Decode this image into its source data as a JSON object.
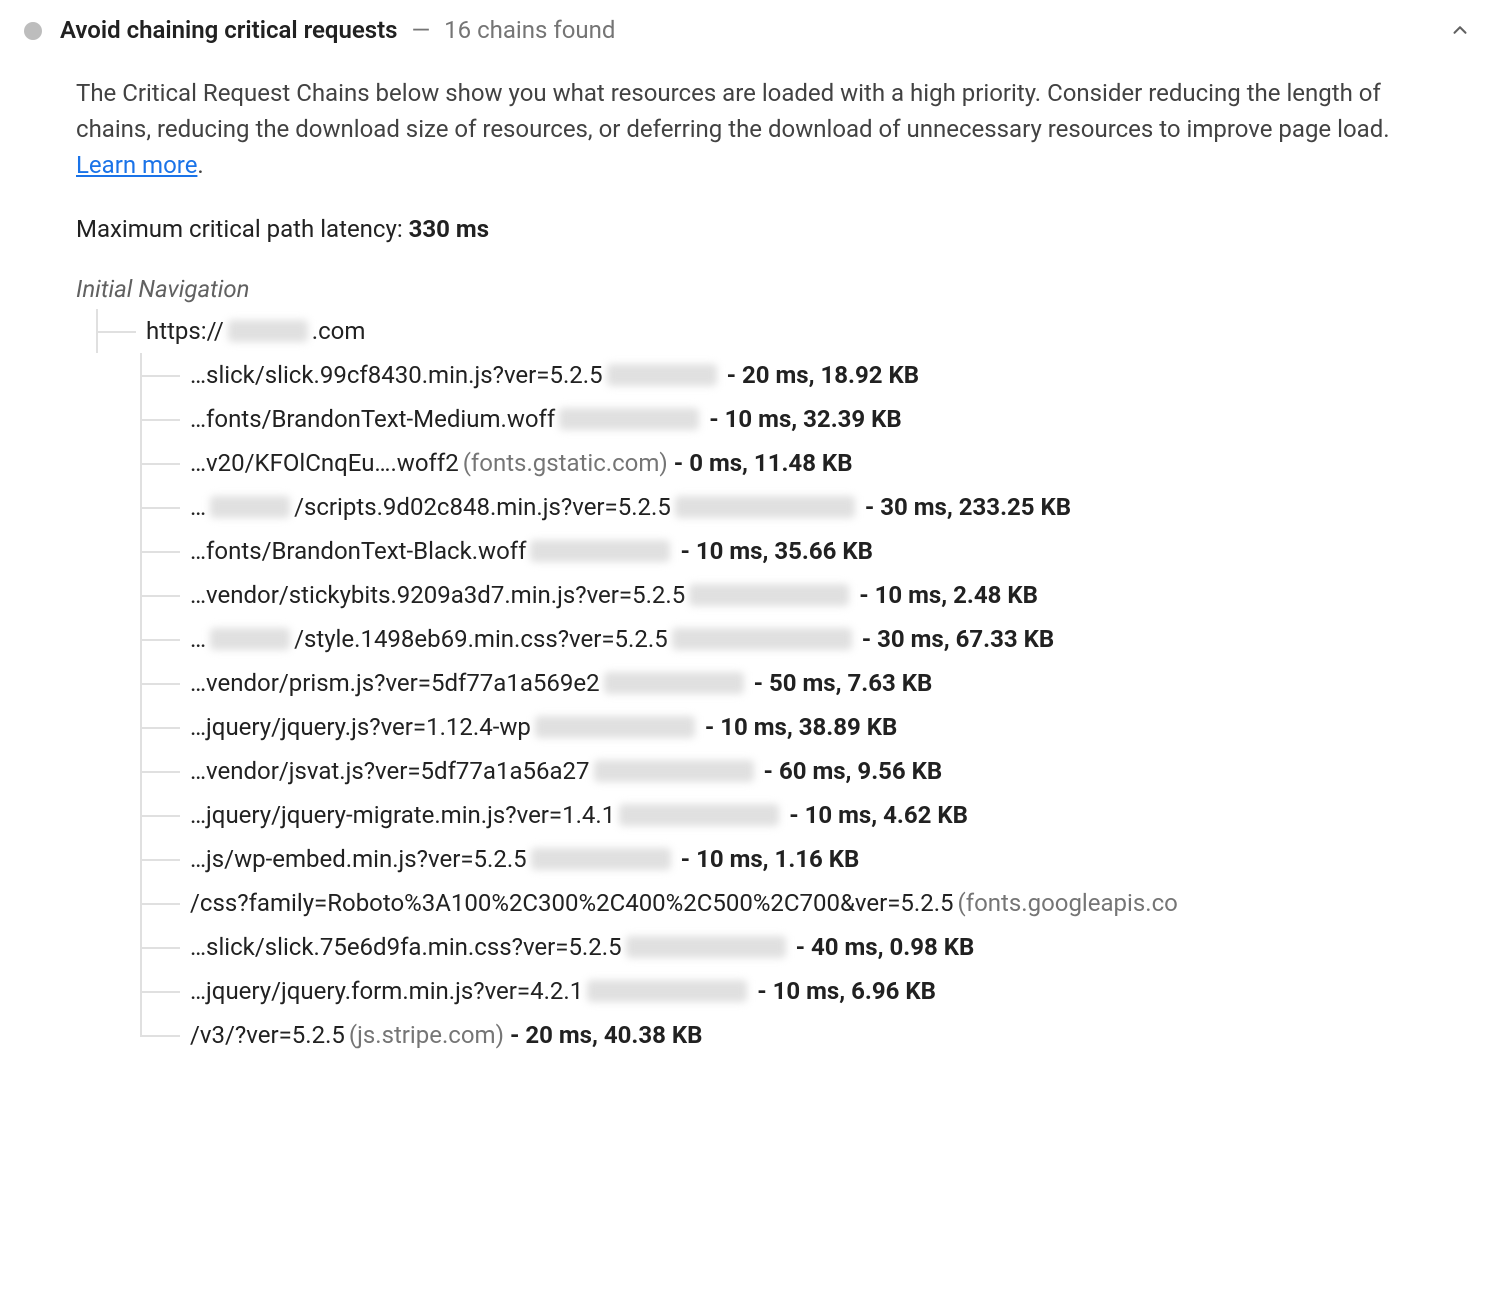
{
  "audit": {
    "title": "Avoid chaining critical requests",
    "separator": "—",
    "subtext": "16 chains found",
    "description_pre": "The Critical Request Chains below show you what resources are loaded with a high priority. Consider reducing the length of chains, reducing the download size of resources, or deferring the download of unnecessary resources to improve page load. ",
    "learn_more": "Learn more",
    "description_post": "."
  },
  "latency": {
    "label": "Maximum critical path latency: ",
    "value": "330 ms"
  },
  "tree": {
    "initial_label": "Initial Navigation",
    "root_url_pre": "https://",
    "root_url_post": ".com",
    "root_host_blurred": true,
    "children": [
      {
        "path": "…slick/slick.99cf8430.min.js?ver=5.2.5",
        "host_blurred": true,
        "host_text": "",
        "time": "20 ms",
        "size": "18.92 KB"
      },
      {
        "path": "…fonts/BrandonText-Medium.woff",
        "host_blurred": true,
        "host_text": "",
        "time": "10 ms",
        "size": "32.39 KB"
      },
      {
        "path": "…v20/KFOlCnqEu….woff2",
        "host_blurred": false,
        "host_text": "(fonts.gstatic.com)",
        "time": "0 ms",
        "size": "11.48 KB"
      },
      {
        "path_pre": "…",
        "path_mid_blurred": true,
        "path_post": "/scripts.9d02c848.min.js?ver=5.2.5",
        "host_blurred": true,
        "host_text": "",
        "time": "30 ms",
        "size": "233.25 KB"
      },
      {
        "path": "…fonts/BrandonText-Black.woff",
        "host_blurred": true,
        "host_text": "",
        "time": "10 ms",
        "size": "35.66 KB"
      },
      {
        "path": "…vendor/stickybits.9209a3d7.min.js?ver=5.2.5",
        "host_blurred": true,
        "host_text": "",
        "time": "10 ms",
        "size": "2.48 KB"
      },
      {
        "path_pre": "…",
        "path_mid_blurred": true,
        "path_post": "/style.1498eb69.min.css?ver=5.2.5",
        "host_blurred": true,
        "host_text": "",
        "time": "30 ms",
        "size": "67.33 KB"
      },
      {
        "path": "…vendor/prism.js?ver=5df77a1a569e2",
        "host_blurred": true,
        "host_text": "",
        "time": "50 ms",
        "size": "7.63 KB"
      },
      {
        "path": "…jquery/jquery.js?ver=1.12.4-wp",
        "host_blurred": true,
        "host_text": "",
        "time": "10 ms",
        "size": "38.89 KB"
      },
      {
        "path": "…vendor/jsvat.js?ver=5df77a1a56a27",
        "host_blurred": true,
        "host_text": "",
        "time": "60 ms",
        "size": "9.56 KB"
      },
      {
        "path": "…jquery/jquery-migrate.min.js?ver=1.4.1",
        "host_blurred": true,
        "host_text": "",
        "time": "10 ms",
        "size": "4.62 KB"
      },
      {
        "path": "…js/wp-embed.min.js?ver=5.2.5",
        "host_blurred": true,
        "host_text": "",
        "time": "10 ms",
        "size": "1.16 KB"
      },
      {
        "path": "/css?family=Roboto%3A100%2C300%2C400%2C500%2C700&ver=5.2.5",
        "host_blurred": false,
        "host_text": "(fonts.googleapis.co",
        "no_metrics": true
      },
      {
        "path": "…slick/slick.75e6d9fa.min.css?ver=5.2.5",
        "host_blurred": true,
        "host_text": "",
        "time": "40 ms",
        "size": "0.98 KB"
      },
      {
        "path": "…jquery/jquery.form.min.js?ver=4.2.1",
        "host_blurred": true,
        "host_text": "",
        "time": "10 ms",
        "size": "6.96 KB"
      },
      {
        "path": "/v3/?ver=5.2.5",
        "host_blurred": false,
        "host_text": "(js.stripe.com)",
        "time": "20 ms",
        "size": "40.38 KB"
      }
    ]
  }
}
